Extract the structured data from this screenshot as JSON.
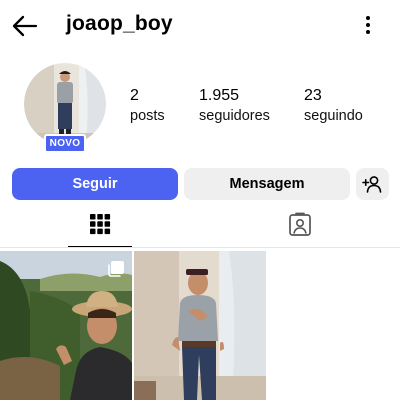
{
  "header": {
    "username": "joaop_boy",
    "back_icon": "arrow-left-icon",
    "menu_icon": "more-vertical-icon"
  },
  "profile": {
    "badge": "NOVO",
    "stats": {
      "posts": {
        "value": "2",
        "label": "posts"
      },
      "followers": {
        "value": "1.955",
        "label": "seguidores"
      },
      "following": {
        "value": "23",
        "label": "seguindo"
      }
    }
  },
  "actions": {
    "follow_label": "Seguir",
    "message_label": "Mensagem",
    "add_user_icon": "add-person-icon"
  },
  "tabs": [
    {
      "name": "posts-grid",
      "icon": "grid-icon",
      "active": true
    },
    {
      "name": "tagged",
      "icon": "tagged-person-icon",
      "active": false
    }
  ],
  "posts": [
    {
      "type": "photo",
      "multi": true
    },
    {
      "type": "photo",
      "multi": false
    }
  ],
  "colors": {
    "accent": "#4c62f0",
    "secondary_button": "#efefef",
    "text": "#000000"
  }
}
